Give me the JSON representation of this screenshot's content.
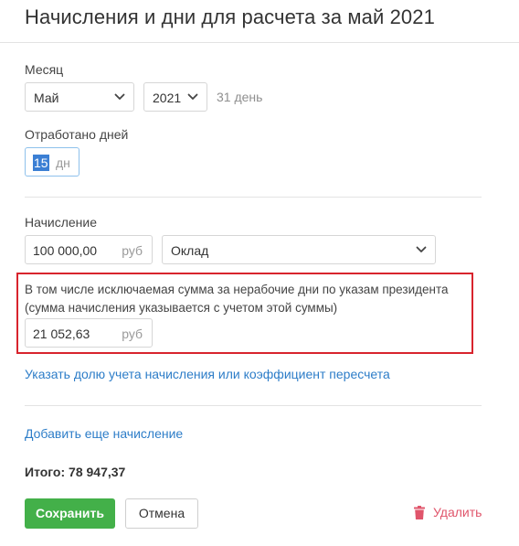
{
  "title": "Начисления и дни для расчета за май 2021",
  "month": {
    "label": "Месяц",
    "month_value": "Май",
    "year_value": "2021",
    "days_hint": "31 день"
  },
  "worked": {
    "label": "Отработано дней",
    "value": "15",
    "unit": "дн"
  },
  "accrual": {
    "label": "Начисление",
    "amount": "100 000,00",
    "unit": "руб",
    "type_value": "Оклад",
    "excluded": {
      "description": "В том числе исключаемая сумма за нерабочие дни по указам президента (сумма начисления указывается с учетом этой суммы)",
      "amount": "21 052,63",
      "unit": "руб"
    },
    "share_link": "Указать долю учета начисления или коэффициент пересчета"
  },
  "add_link": "Добавить еще начисление",
  "total": "Итого: 78 947,37",
  "buttons": {
    "save": "Сохранить",
    "cancel": "Отмена",
    "delete": "Удалить"
  },
  "icons": {
    "select_arrow": "chevron-down-icon",
    "delete": "trash-icon"
  },
  "colors": {
    "primary_button": "#43b049",
    "link": "#2d7dc8",
    "delete": "#e0556b",
    "highlight_border": "#d8242d",
    "focus_border": "#8ec1ec"
  }
}
